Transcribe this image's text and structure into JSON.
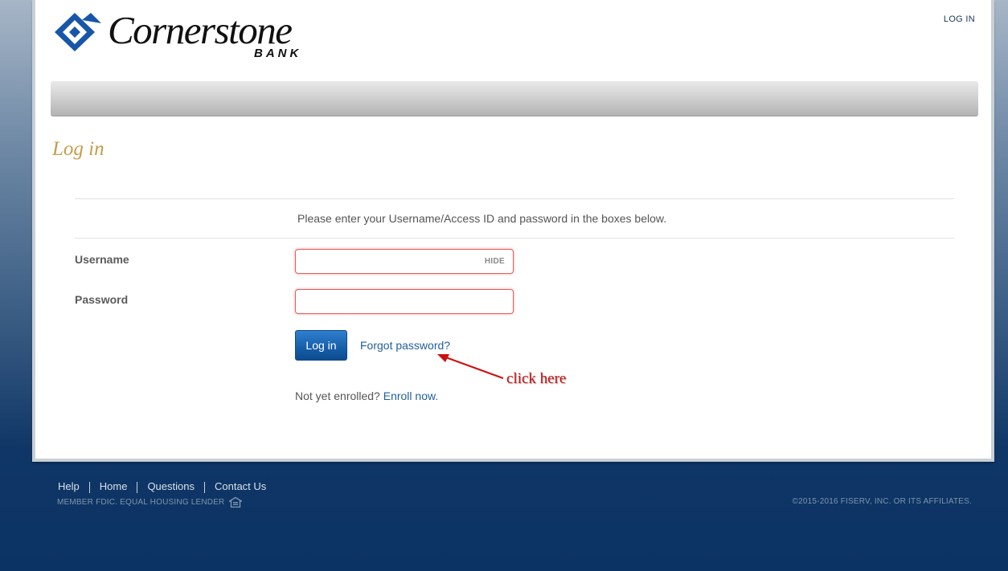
{
  "header": {
    "logo_word": "Cornerstone",
    "logo_sub": "BANK",
    "login_link": "LOG IN"
  },
  "main": {
    "title": "Log in",
    "instructions": "Please enter your Username/Access ID and password in the boxes below.",
    "username_label": "Username",
    "password_label": "Password",
    "username_value": "",
    "password_value": "",
    "hide_toggle": "HIDE",
    "login_button": "Log in",
    "forgot_link": "Forgot password?",
    "enroll_prefix": "Not yet enrolled?",
    "enroll_link": "Enroll now",
    "enroll_suffix": "."
  },
  "annotation": {
    "text": "click here",
    "color": "#cc1010"
  },
  "footer": {
    "links": [
      "Help",
      "Home",
      "Questions",
      "Contact Us"
    ],
    "member_text": "MEMBER FDIC. EQUAL HOUSING LENDER",
    "equal_housing_icon": "equal-housing-lender-icon",
    "copyright": "©2015-2016 FISERV, INC. OR ITS AFFILIATES."
  },
  "colors": {
    "brand_blue": "#1756a8",
    "title_gold": "#c69c4a",
    "link_blue": "#1f5f9a",
    "error_red": "#e06262"
  }
}
